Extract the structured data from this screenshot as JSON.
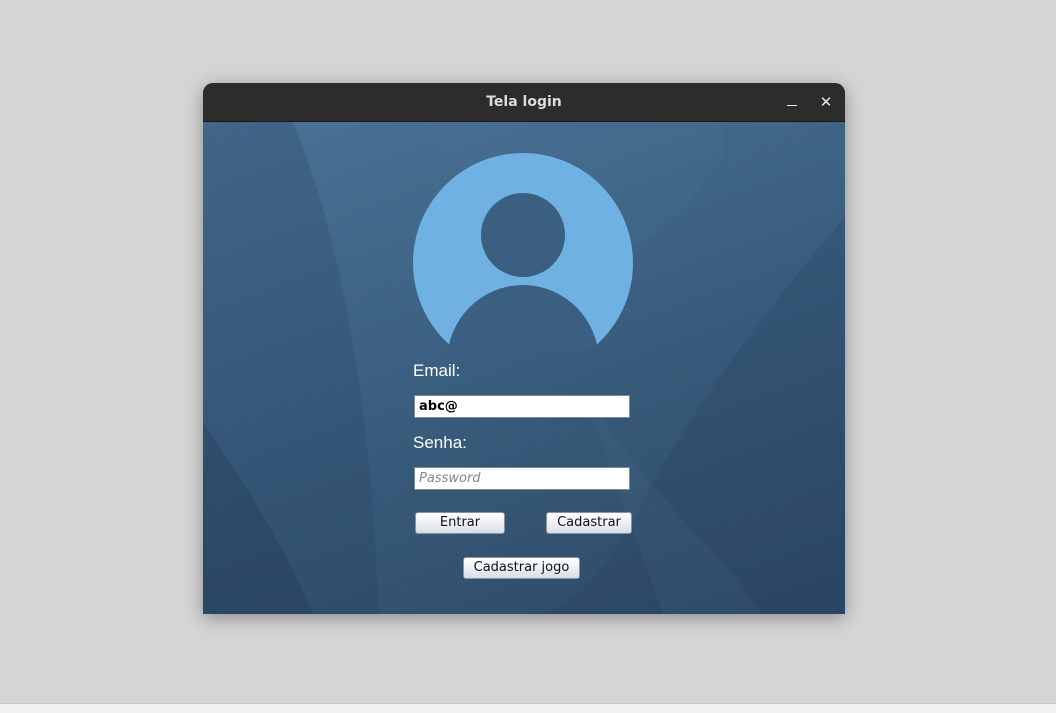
{
  "window": {
    "title": "Tela login",
    "minimize_glyph": "_",
    "close_glyph": "✕"
  },
  "avatar": {
    "icon": "user-avatar-icon",
    "color": "#6fb1e2"
  },
  "form": {
    "email_label": "Email:",
    "email_value": "abc@",
    "password_label": "Senha:",
    "password_placeholder": "Password",
    "password_value": ""
  },
  "buttons": {
    "login": "Entrar",
    "register": "Cadastrar",
    "register_game": "Cadastrar jogo"
  },
  "colors": {
    "titlebar": "#2c2c2c",
    "background": "#3b5f80"
  }
}
